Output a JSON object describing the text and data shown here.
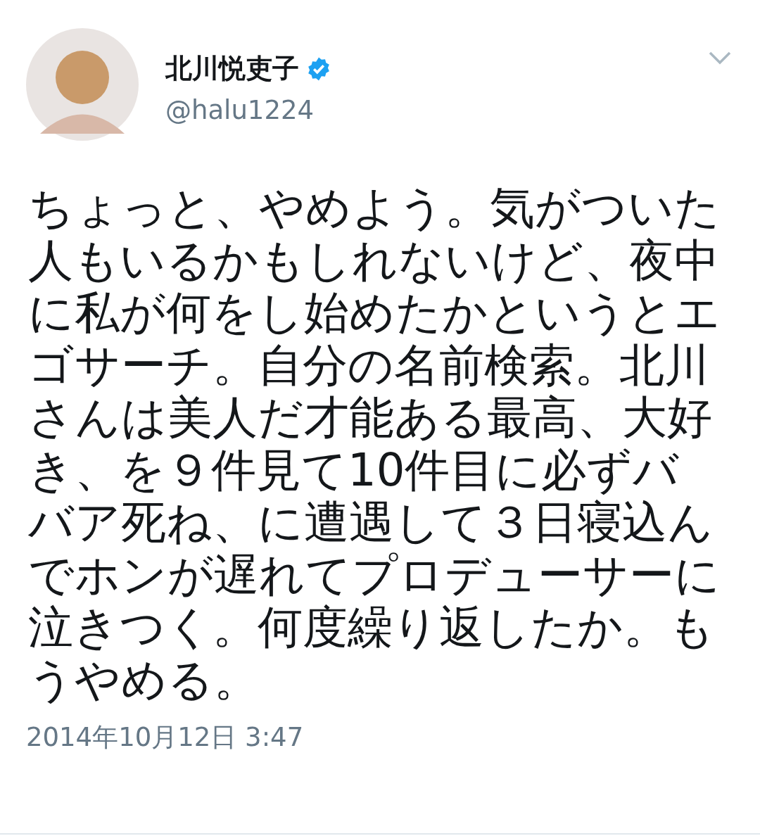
{
  "tweet": {
    "author": {
      "name": "北川悦吏子",
      "verified": true,
      "handle": "@halu1224"
    },
    "text": "ちょっと、やめよう。気がついた人もいるかもしれないけど、夜中に私が何をし始めたかというとエゴサーチ。自分の名前検索。北川さんは美人だ才能ある最高、大好き、を９件見て10件目に必ずババア死ね、に遭遇して３日寝込んでホンが遅れてプロデューサーに泣きつく。何度繰り返したか。もうやめる。",
    "timestamp": "2014年10月12日 3:47"
  }
}
